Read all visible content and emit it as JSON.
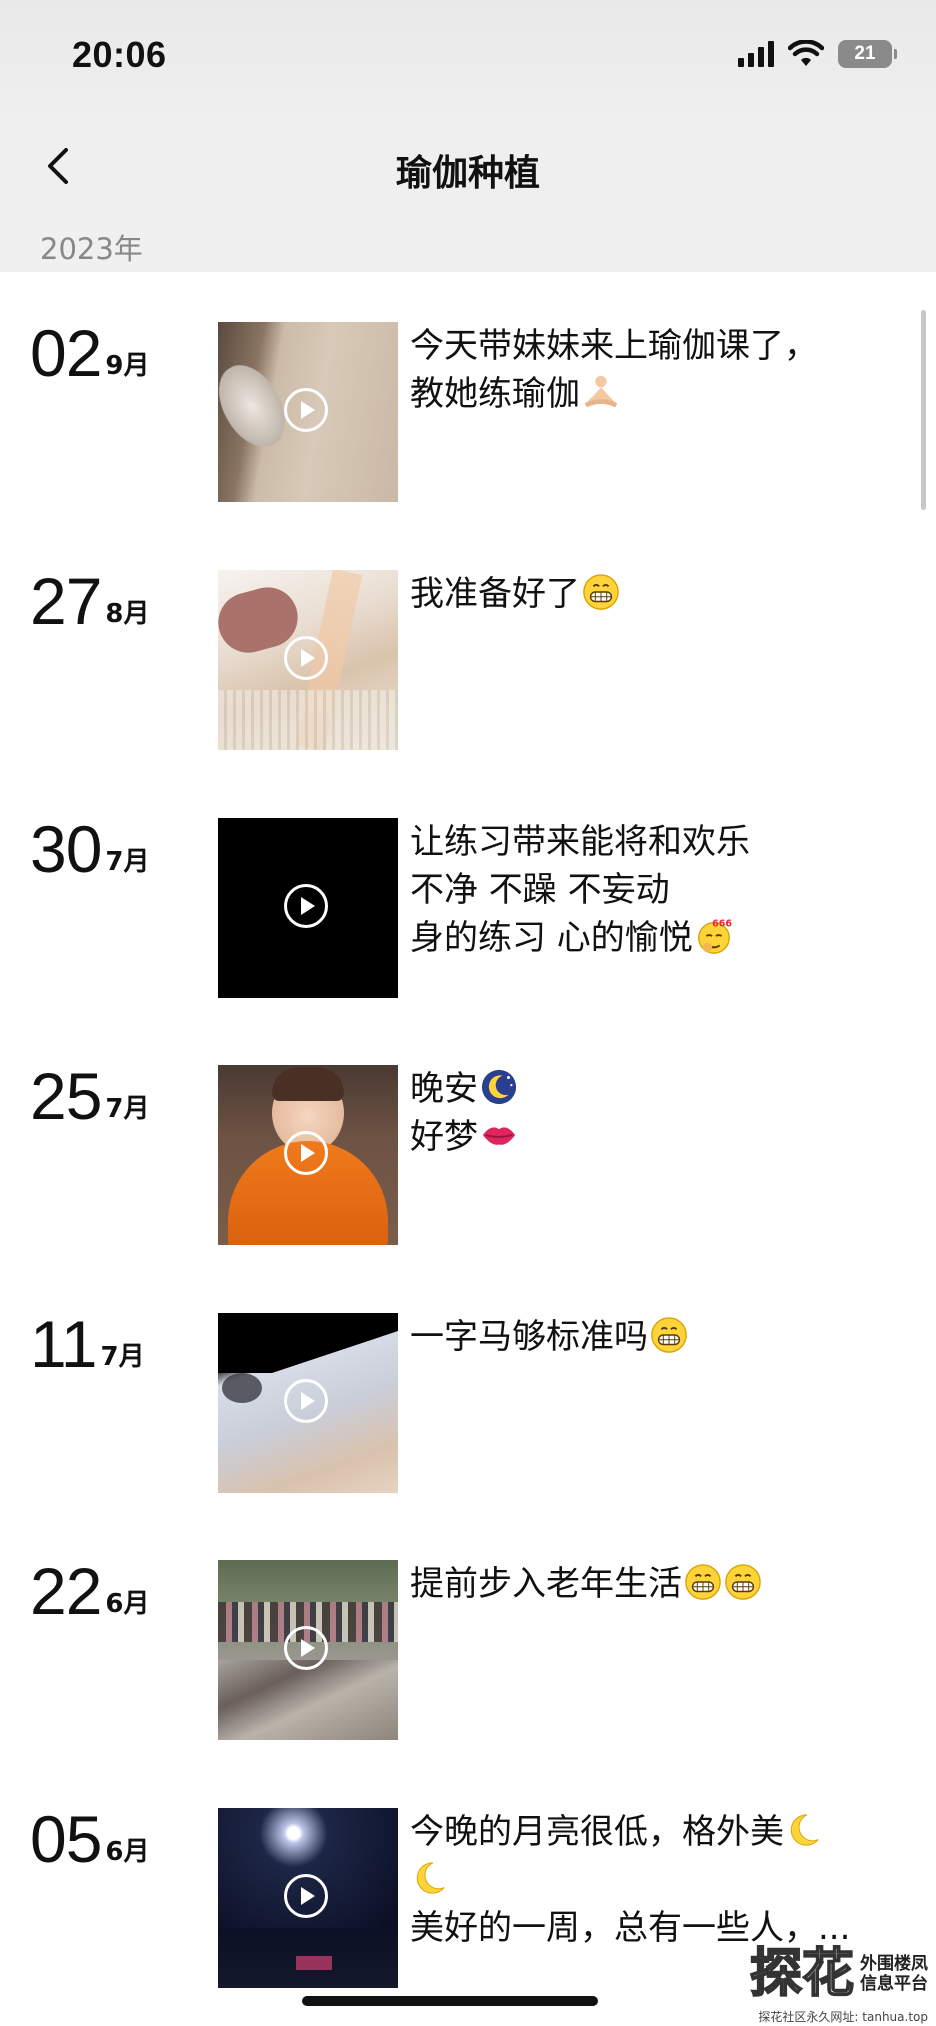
{
  "status": {
    "time": "20:06",
    "battery": "21"
  },
  "nav": {
    "title": "瑜伽种植"
  },
  "year_label": "2023年",
  "posts": [
    {
      "day": "02",
      "month": "9月",
      "lines": [
        "今天带妹妹来上瑜伽课了，",
        "教她练瑜伽"
      ],
      "emoji": [
        "meditation-emoji"
      ]
    },
    {
      "day": "27",
      "month": "8月",
      "lines": [
        "我准备好了"
      ],
      "emoji": [
        "grin-emoji"
      ]
    },
    {
      "day": "30",
      "month": "7月",
      "lines": [
        "让练习带来能将和欢乐",
        "不净 不躁 不妄动",
        "身的练习 心的愉悦"
      ],
      "emoji": [
        "666-emoji"
      ]
    },
    {
      "day": "25",
      "month": "7月",
      "lines": [
        "晚安",
        "好梦"
      ],
      "emoji": [
        "moon-emoji",
        "lips-emoji"
      ]
    },
    {
      "day": "11",
      "month": "7月",
      "lines": [
        "一字马够标准吗"
      ],
      "emoji": [
        "grin-emoji"
      ]
    },
    {
      "day": "22",
      "month": "6月",
      "lines": [
        "提前步入老年生活"
      ],
      "emoji": [
        "grin-emoji",
        "grin-emoji"
      ]
    },
    {
      "day": "05",
      "month": "6月",
      "lines": [
        "今晚的月亮很低，格外美",
        "",
        "美好的一周，总有一些人，..."
      ],
      "emoji": [
        "crescent-moon-emoji",
        "crescent-moon-emoji"
      ]
    }
  ],
  "watermark": {
    "logo": "探花",
    "line1": "外围楼凤",
    "line2": "信息平台",
    "url": "探花社区永久网址: tanhua.top"
  }
}
